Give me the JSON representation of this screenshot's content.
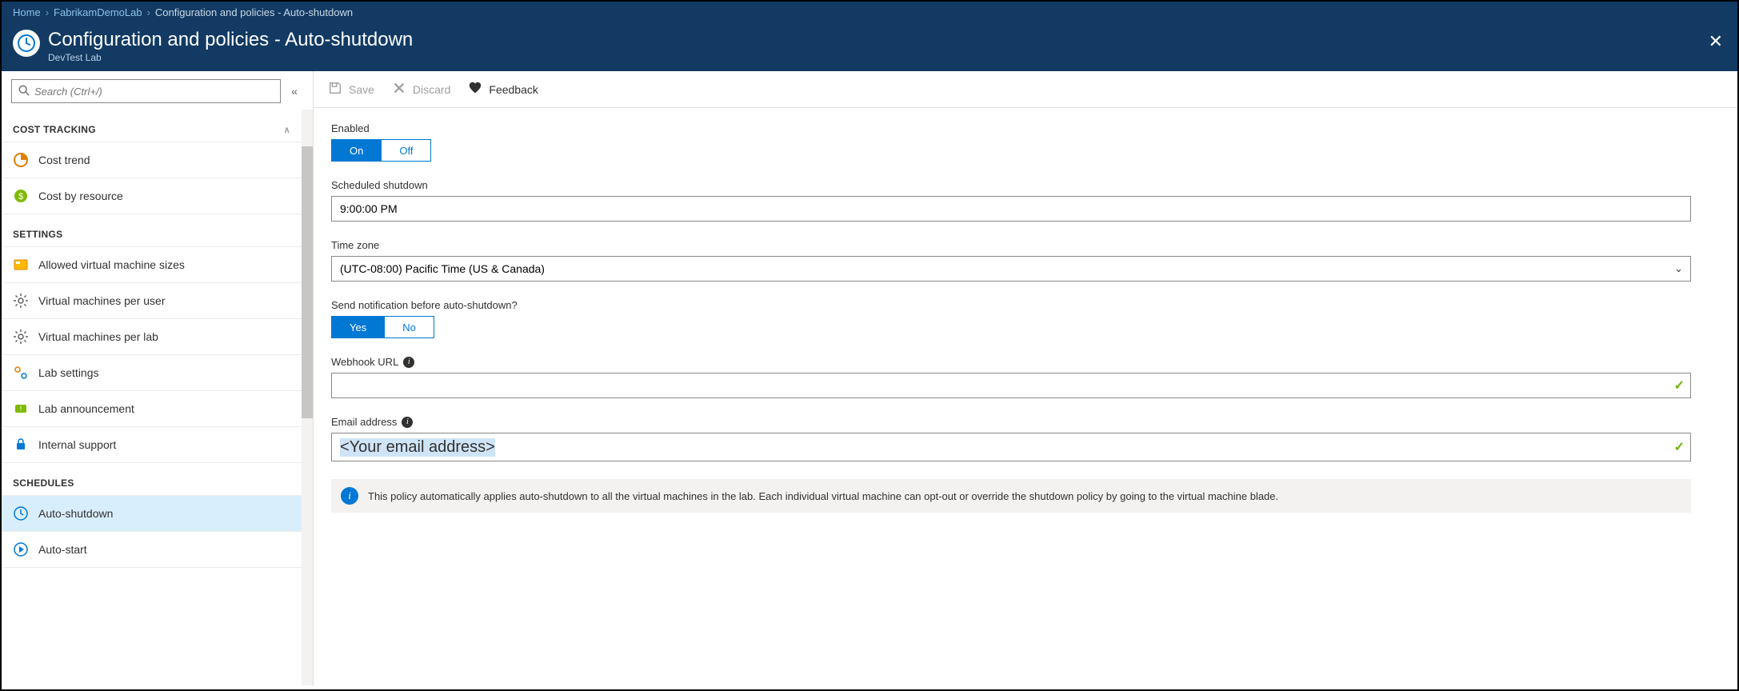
{
  "breadcrumb": {
    "home": "Home",
    "lab": "FabrikamDemoLab",
    "current": "Configuration and policies - Auto-shutdown"
  },
  "header": {
    "title": "Configuration and policies - Auto-shutdown",
    "subtitle": "DevTest Lab"
  },
  "search": {
    "placeholder": "Search (Ctrl+/)"
  },
  "sidebar": {
    "sections": [
      {
        "title": "COST TRACKING",
        "items": [
          {
            "label": "Cost trend"
          },
          {
            "label": "Cost by resource"
          }
        ]
      },
      {
        "title": "SETTINGS",
        "items": [
          {
            "label": "Allowed virtual machine sizes"
          },
          {
            "label": "Virtual machines per user"
          },
          {
            "label": "Virtual machines per lab"
          },
          {
            "label": "Lab settings"
          },
          {
            "label": "Lab announcement"
          },
          {
            "label": "Internal support"
          }
        ]
      },
      {
        "title": "SCHEDULES",
        "items": [
          {
            "label": "Auto-shutdown",
            "selected": true
          },
          {
            "label": "Auto-start"
          }
        ]
      }
    ]
  },
  "toolbar": {
    "save": "Save",
    "discard": "Discard",
    "feedback": "Feedback"
  },
  "form": {
    "enabled_label": "Enabled",
    "enabled_on": "On",
    "enabled_off": "Off",
    "scheduled_label": "Scheduled shutdown",
    "scheduled_value": "9:00:00 PM",
    "timezone_label": "Time zone",
    "timezone_value": "(UTC-08:00) Pacific Time (US & Canada)",
    "notify_label": "Send notification before auto-shutdown?",
    "notify_yes": "Yes",
    "notify_no": "No",
    "webhook_label": "Webhook URL",
    "webhook_value": "",
    "email_label": "Email address",
    "email_value": "<Your email address>",
    "info_text": "This policy automatically applies auto-shutdown to all the virtual machines in the lab. Each individual virtual machine can opt-out or override the shutdown policy by going to the virtual machine blade."
  }
}
